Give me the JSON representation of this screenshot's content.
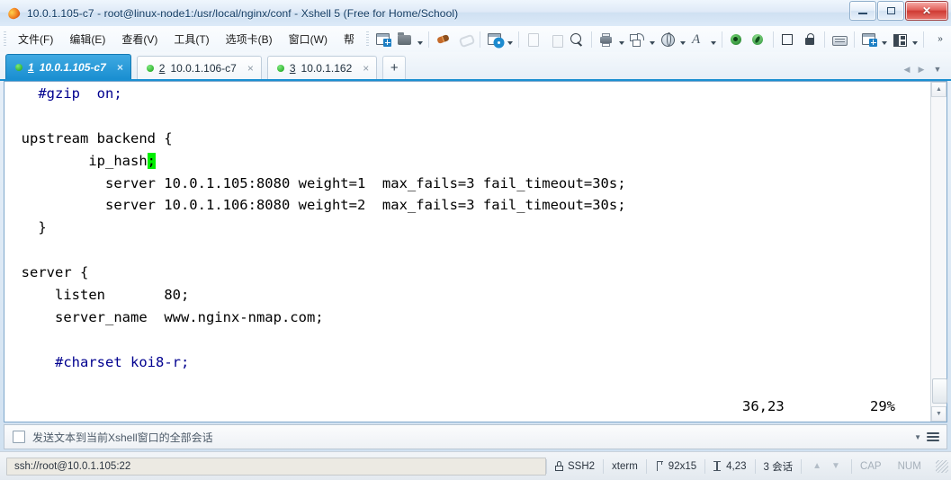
{
  "window": {
    "title": "10.0.1.105-c7 - root@linux-node1:/usr/local/nginx/conf - Xshell 5 (Free for Home/School)",
    "app_icon": "xshell-leaf-icon",
    "minimize_label": "—",
    "restore_label": "❐",
    "close_label": "✕"
  },
  "menubar": {
    "items": [
      {
        "label": "文件(F)",
        "name": "menu-file"
      },
      {
        "label": "编辑(E)",
        "name": "menu-edit"
      },
      {
        "label": "查看(V)",
        "name": "menu-view"
      },
      {
        "label": "工具(T)",
        "name": "menu-tools"
      },
      {
        "label": "选项卡(B)",
        "name": "menu-tabs"
      },
      {
        "label": "窗口(W)",
        "name": "menu-window"
      },
      {
        "label": "帮",
        "name": "menu-help"
      }
    ],
    "overflow_label": "»"
  },
  "toolbar": {
    "icons": [
      "new-session-icon",
      "open-folder-icon",
      "connect-icon",
      "disconnect-icon",
      "session-properties-icon",
      "copy-icon",
      "paste-icon",
      "find-icon",
      "print-icon",
      "file-transfer-icon",
      "web-browser-icon",
      "font-icon",
      "highlight-green-icon",
      "trace-green-icon",
      "fullscreen-icon",
      "lock-icon",
      "keyboard-icon",
      "new-folder-icon",
      "layout-split-icon"
    ]
  },
  "tabs": {
    "items": [
      {
        "num": "1",
        "label": "10.0.1.105-c7",
        "active": true,
        "status": "connected"
      },
      {
        "num": "2",
        "label": "10.0.1.106-c7",
        "active": false,
        "status": "connected"
      },
      {
        "num": "3",
        "label": "10.0.1.162",
        "active": false,
        "status": "connected"
      }
    ],
    "new_tab_label": "+",
    "close_label": "×",
    "scroll_left_label": "◀",
    "scroll_right_label": "▶",
    "list_label": "▼"
  },
  "terminal": {
    "lines": [
      {
        "indent": "    ",
        "segments": [
          {
            "text": "#gzip  on;",
            "style": "comment"
          }
        ]
      },
      {
        "indent": "",
        "segments": [
          {
            "text": "",
            "style": "plain"
          }
        ]
      },
      {
        "indent": "  ",
        "segments": [
          {
            "text": "upstream backend {",
            "style": "plain"
          }
        ]
      },
      {
        "indent": "          ",
        "segments": [
          {
            "text": "ip_hash",
            "style": "plain"
          },
          {
            "text": ";",
            "style": "cursor"
          }
        ]
      },
      {
        "indent": "            ",
        "segments": [
          {
            "text": "server 10.0.1.105:8080 weight=1  max_fails=3 fail_timeout=30s;",
            "style": "plain"
          }
        ]
      },
      {
        "indent": "            ",
        "segments": [
          {
            "text": "server 10.0.1.106:8080 weight=2  max_fails=3 fail_timeout=30s;",
            "style": "plain"
          }
        ]
      },
      {
        "indent": "    ",
        "segments": [
          {
            "text": "}",
            "style": "plain"
          }
        ]
      },
      {
        "indent": "",
        "segments": [
          {
            "text": "",
            "style": "plain"
          }
        ]
      },
      {
        "indent": "  ",
        "segments": [
          {
            "text": "server {",
            "style": "plain"
          }
        ]
      },
      {
        "indent": "      ",
        "segments": [
          {
            "text": "listen       80;",
            "style": "plain"
          }
        ]
      },
      {
        "indent": "      ",
        "segments": [
          {
            "text": "server_name  www.nginx-nmap.com;",
            "style": "plain"
          }
        ]
      },
      {
        "indent": "",
        "segments": [
          {
            "text": "",
            "style": "plain"
          }
        ]
      },
      {
        "indent": "      ",
        "segments": [
          {
            "text": "#charset koi8-r;",
            "style": "comment"
          }
        ]
      }
    ],
    "vim_status": {
      "position": "36,23",
      "percent": "29%"
    },
    "colors": {
      "background": "#ffffff",
      "foreground": "#000000",
      "comment": "#00008f",
      "cursor": "#00ee00"
    },
    "scrollbar": {
      "up_label": "▲",
      "down_label": "▼"
    }
  },
  "command_bar": {
    "checkbox_checked": false,
    "label": "发送文本到当前Xshell窗口的全部会话",
    "caret_label": "▼",
    "menu_icon": "hamburger-menu-icon"
  },
  "statusbar": {
    "connection": "ssh://root@10.0.1.105:22",
    "protocol": "SSH2",
    "terminal_type": "xterm",
    "size": "92x15",
    "cursor": "4,23",
    "sessions": "3 会话",
    "caps": "CAP",
    "num": "NUM",
    "up_arrow": "▲",
    "down_arrow": "▼"
  }
}
